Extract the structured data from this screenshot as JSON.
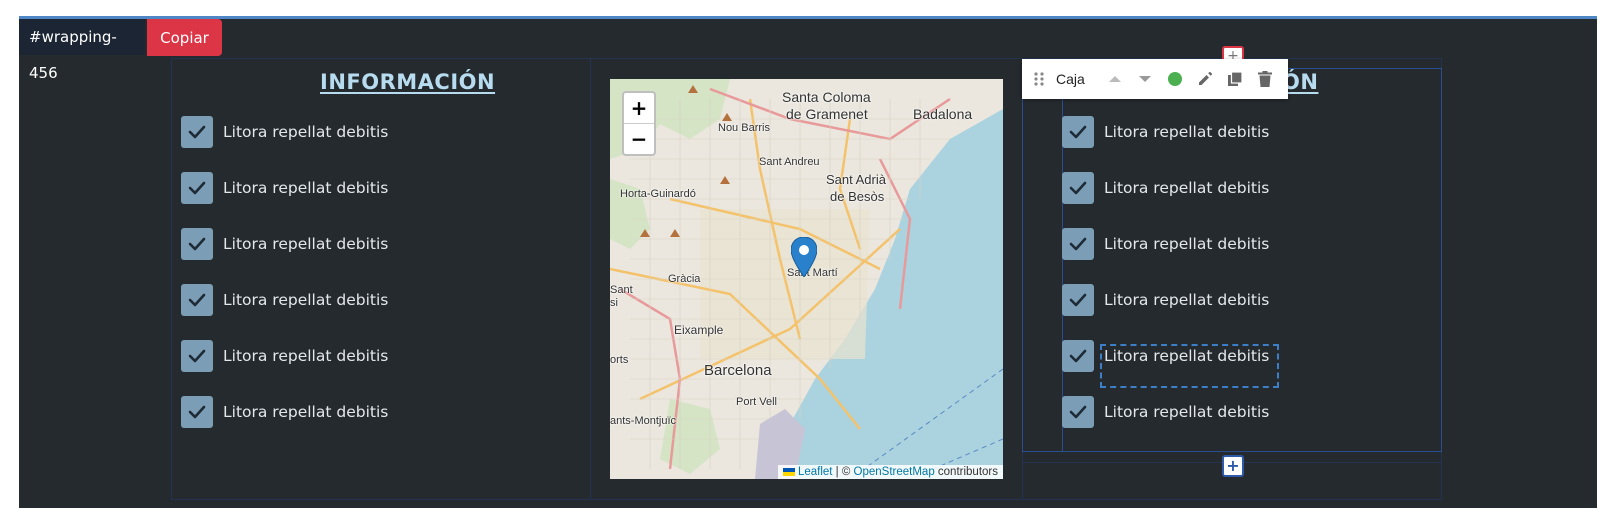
{
  "editor": {
    "wrapper_tag": "#wrapping-456",
    "copy_label": "Copiar"
  },
  "left_column": {
    "heading": "INFORMACIÓN",
    "items": [
      {
        "label": "Litora repellat debitis",
        "checked": true
      },
      {
        "label": "Litora repellat debitis",
        "checked": true
      },
      {
        "label": "Litora repellat debitis",
        "checked": true
      },
      {
        "label": "Litora repellat debitis",
        "checked": true
      },
      {
        "label": "Litora repellat debitis",
        "checked": true
      },
      {
        "label": "Litora repellat debitis",
        "checked": true
      }
    ]
  },
  "right_column": {
    "heading_visible_part": "ÓN",
    "items": [
      {
        "label": "Litora repellat debitis",
        "checked": true
      },
      {
        "label": "Litora repellat debitis",
        "checked": true
      },
      {
        "label": "Litora repellat debitis",
        "checked": true
      },
      {
        "label": "Litora repellat debitis",
        "checked": true
      },
      {
        "label": "Litora repellat debitis",
        "checked": true,
        "selected": true
      },
      {
        "label": "Litora repellat debitis",
        "checked": true
      }
    ]
  },
  "toolbar": {
    "block_name": "Caja",
    "status_color": "#4caf50",
    "icons": [
      "drag-handle-icon",
      "move-up-icon",
      "move-down-icon",
      "status-dot-icon",
      "edit-icon",
      "duplicate-icon",
      "delete-icon"
    ]
  },
  "map": {
    "zoom_in": "+",
    "zoom_out": "−",
    "labels": {
      "santa_coloma_1": "Santa Coloma",
      "santa_coloma_2": "de Gramenet",
      "badalona": "Badalona",
      "nou_barris": "Nou Barris",
      "sant_andreu": "Sant Andreu",
      "horta": "Horta-Guinardó",
      "sant_adria_1": "Sant Adrià",
      "sant_adria_2": "de Besòs",
      "gracia": "Gràcia",
      "sant": "Sant",
      "si": "si",
      "sant_marti": "Sant Martí",
      "eixample": "Eixample",
      "barcelona": "Barcelona",
      "orts": "orts",
      "port_vell": "Port Vell",
      "sants_montjuic": "ants-Montjuïc"
    },
    "attribution": {
      "leaflet": "Leaflet",
      "separator": " | © ",
      "osm": "OpenStreetMap",
      "suffix": " contributors"
    },
    "colors": {
      "water": "#aad3df",
      "land": "#eeeae3",
      "marker": "#2a81cb"
    }
  },
  "insert_controls": {
    "plus": "+"
  }
}
